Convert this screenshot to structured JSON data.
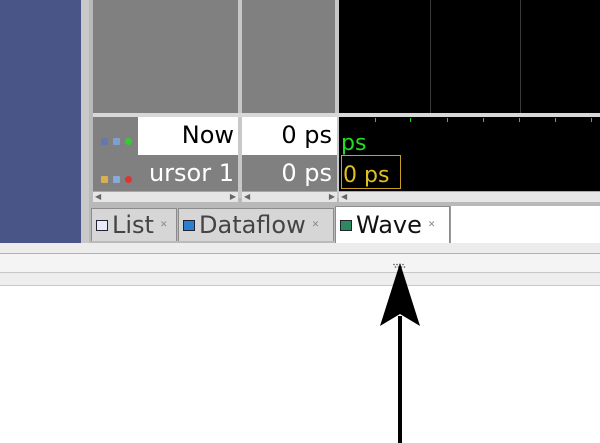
{
  "signals": {
    "now": {
      "name": "Now",
      "value": "0 ps",
      "wave_label": "ps"
    },
    "cursor": {
      "name": "ursor 1",
      "value": "0 ps",
      "wave_label": "0 ps"
    }
  },
  "tabs": [
    {
      "label": "List",
      "icon": "list-icon",
      "active": false
    },
    {
      "label": "Dataflow",
      "icon": "dataflow-icon",
      "active": false
    },
    {
      "label": "Wave",
      "icon": "wave-icon",
      "active": true
    }
  ],
  "colors": {
    "wave_background": "#000000",
    "now_text": "#22dd22",
    "cursor_text": "#e0c020",
    "left_panel": "#4a5587"
  }
}
